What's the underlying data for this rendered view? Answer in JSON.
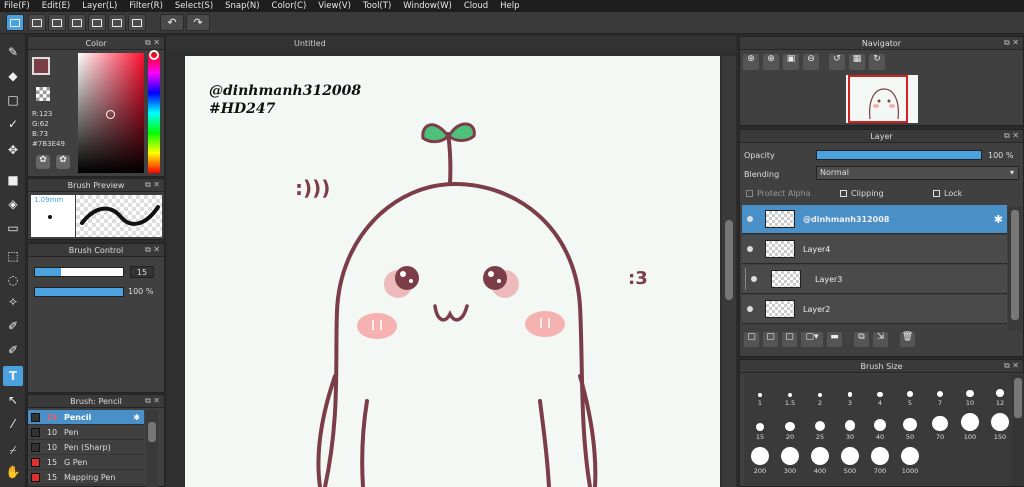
{
  "menu": [
    "File(F)",
    "Edit(E)",
    "Layer(L)",
    "Filter(R)",
    "Select(S)",
    "Snap(N)",
    "Color(C)",
    "View(V)",
    "Tool(T)",
    "Window(W)",
    "Cloud",
    "Help"
  ],
  "color_panel": {
    "title": "Color",
    "r": "R:123",
    "g": "G:62",
    "b": "B:73",
    "hex": "#7B3E49",
    "main_color": "#7b3e49"
  },
  "brush_preview": {
    "title": "Brush Preview",
    "size": "1.09mm"
  },
  "brush_control": {
    "title": "Brush Control",
    "size_value": "15",
    "opacity_value": "100 %"
  },
  "brush_list": {
    "title": "Brush: Pencil",
    "items": [
      {
        "size": "15",
        "name": "Pencil",
        "color": "#333333",
        "selected": true
      },
      {
        "size": "10",
        "name": "Pen",
        "color": "#333333",
        "selected": false
      },
      {
        "size": "10",
        "name": "Pen (Sharp)",
        "color": "#333333",
        "selected": false
      },
      {
        "size": "15",
        "name": "G Pen",
        "color": "#e03030",
        "selected": false
      },
      {
        "size": "15",
        "name": "Mapping Pen",
        "color": "#e03030",
        "selected": false
      }
    ]
  },
  "canvas": {
    "tab_title": "Untitled",
    "text_line1": "@dinhmanh312008",
    "text_line2": "#HD247",
    "text_face": ":3",
    "text_sound": ":)))"
  },
  "navigator": {
    "title": "Navigator"
  },
  "layer_panel": {
    "title": "Layer",
    "opacity_label": "Opacity",
    "opacity_value": "100 %",
    "blending_label": "Blending",
    "blending_value": "Normal",
    "protect_alpha": "Protect Alpha",
    "clipping": "Clipping",
    "lock": "Lock",
    "layers": [
      {
        "name": "@dinhmanh312008",
        "selected": true
      },
      {
        "name": "Layer4",
        "selected": false
      },
      {
        "name": "Layer3",
        "selected": false
      },
      {
        "name": "Layer2",
        "selected": false
      }
    ]
  },
  "brush_size": {
    "title": "Brush Size",
    "sizes": [
      "1",
      "1.5",
      "2",
      "3",
      "4",
      "5",
      "7",
      "10",
      "12",
      "15",
      "20",
      "25",
      "30",
      "40",
      "50",
      "70",
      "100",
      "150",
      "200",
      "300",
      "400",
      "500",
      "700",
      "1000"
    ]
  }
}
